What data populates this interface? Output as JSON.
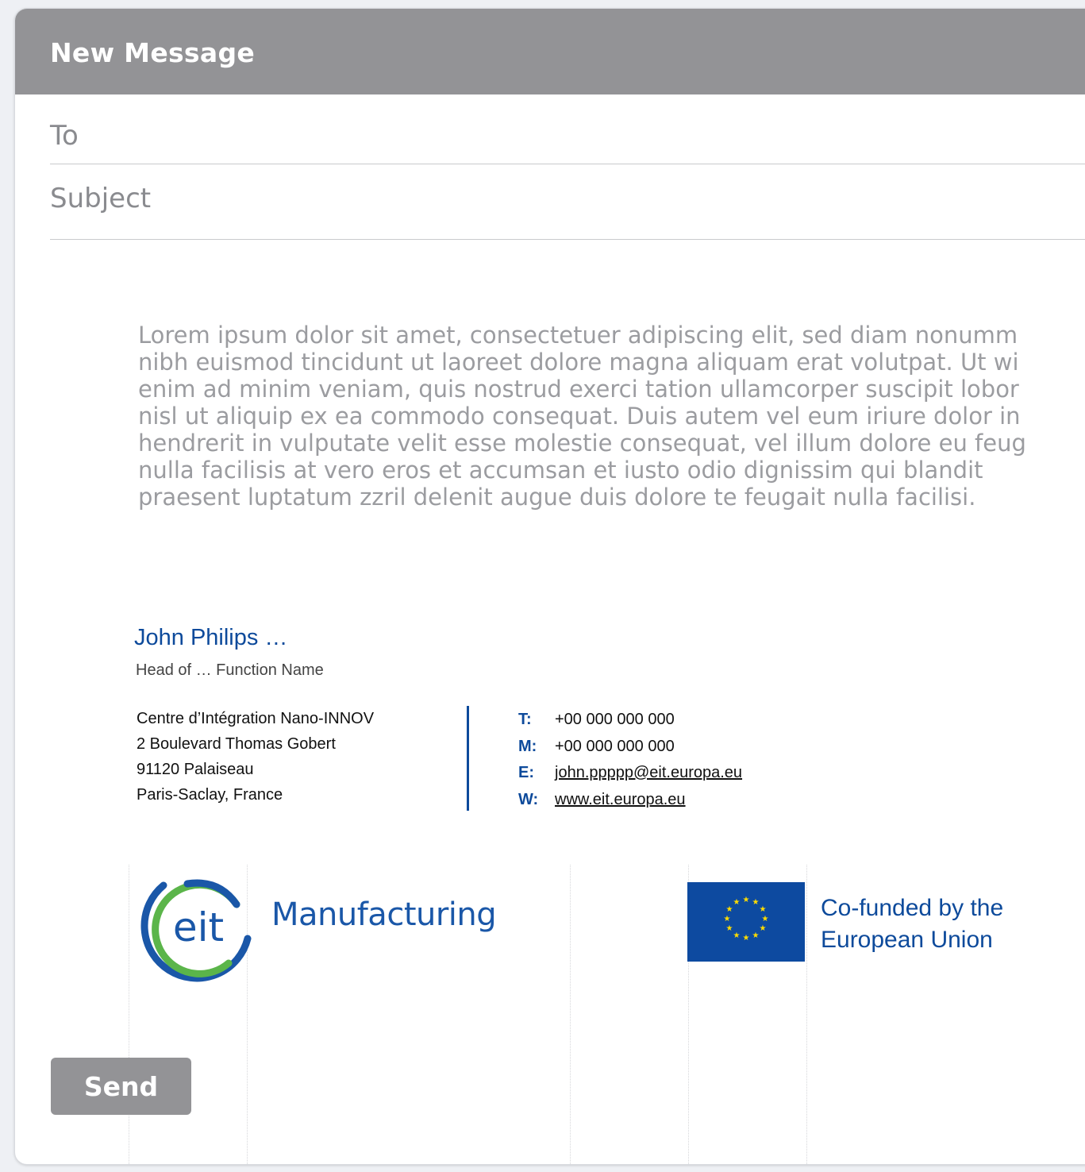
{
  "header": {
    "title": "New Message"
  },
  "fields": {
    "to_placeholder": "To",
    "subject_placeholder": "Subject"
  },
  "body_lines": [
    "Lorem ipsum dolor sit amet, consectetuer adipiscing elit, sed diam nonumm",
    "nibh euismod tincidunt ut laoreet dolore magna aliquam erat volutpat. Ut wi",
    "enim ad minim veniam, quis nostrud exerci tation ullamcorper suscipit lobor",
    "nisl ut aliquip ex ea commodo consequat. Duis autem vel eum iriure dolor in",
    "hendrerit in vulputate velit esse molestie consequat, vel illum dolore eu feug",
    "nulla facilisis at vero eros et accumsan et iusto odio dignissim qui blandit",
    "praesent luptatum zzril delenit augue duis dolore te feugait nulla facilisi."
  ],
  "signature": {
    "name": "John Philips …",
    "role": "Head of … Function Name",
    "address": [
      "Centre d’Intégration Nano-INNOV",
      "2 Boulevard Thomas Gobert",
      "91120 Palaiseau",
      "Paris-Saclay, France"
    ],
    "contacts": {
      "phone_label": "T:",
      "phone": "+00 000 000 000",
      "mobile_label": "M:",
      "mobile": "+00 000 000 000",
      "email_label": "E:",
      "email": "john.ppppp@eit.europa.eu",
      "web_label": "W:",
      "web": "www.eit.europa.eu"
    }
  },
  "logos": {
    "eit_letters": "eit",
    "eit_word": "Manufacturing",
    "eu_line1": "Co-funded by the",
    "eu_line2": "European Union"
  },
  "actions": {
    "send_label": "Send"
  },
  "colors": {
    "header_gray": "#939396",
    "brand_blue": "#0d4a9b",
    "eit_green": "#5bb54a",
    "eu_yellow": "#ffdd00"
  }
}
